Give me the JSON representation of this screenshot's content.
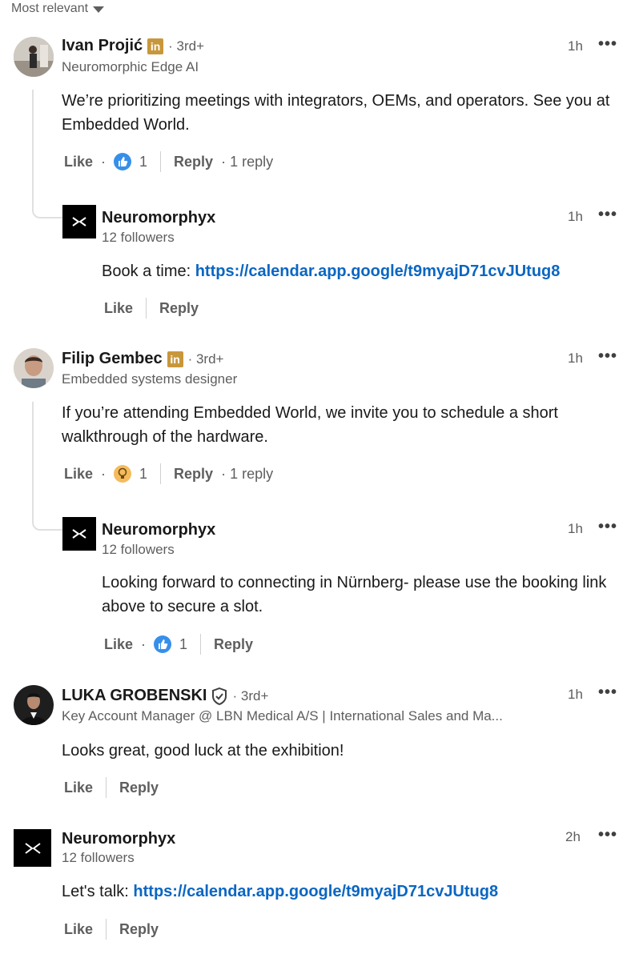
{
  "sort": {
    "label": "Most relevant"
  },
  "actions_common": {
    "like": "Like",
    "reply": "Reply",
    "dot": "·",
    "more": "•••"
  },
  "comments": [
    {
      "name": "Ivan Projić",
      "degree": "· 3rd+",
      "subtitle": "Neuromorphic Edge AI",
      "time": "1h",
      "text": "We’re prioritizing meetings with integrators, OEMs, and operators. See you at Embedded World.",
      "reaction_count": "1",
      "reply_count": "· 1 reply",
      "reply": {
        "name": "Neuromorphyx",
        "subtitle": "12 followers",
        "time": "1h",
        "text_prefix": "Book a time: ",
        "link": "https://calendar.app.google/t9myajD71cvJUtug8"
      }
    },
    {
      "name": "Filip Gembec",
      "degree": "· 3rd+",
      "subtitle": "Embedded systems designer",
      "time": "1h",
      "text": "If you’re attending Embedded World, we invite you to schedule a short walkthrough of the hardware.",
      "reaction_count": "1",
      "reply_count": "· 1 reply",
      "reply": {
        "name": "Neuromorphyx",
        "subtitle": "12 followers",
        "time": "1h",
        "text": "Looking forward to connecting in Nürnberg- please use the booking link above to secure a slot.",
        "reaction_count": "1"
      }
    },
    {
      "name": "LUKA GROBENSKI",
      "degree": "· 3rd+",
      "subtitle": "Key Account Manager @ LBN Medical A/S | International Sales and Ma...",
      "time": "1h",
      "text": "Looks great, good luck at the exhibition!"
    },
    {
      "name": "Neuromorphyx",
      "subtitle": "12 followers",
      "time": "2h",
      "text_prefix": "Let's talk: ",
      "link": "https://calendar.app.google/t9myajD71cvJUtug8"
    }
  ],
  "colors": {
    "link": "#0a66c2",
    "linkedin_badge": "#c8973b",
    "like_reaction": "#378fe9",
    "insight_reaction": "#f5bb5c"
  },
  "icons": [
    "caret-down-icon",
    "linkedin-badge-icon",
    "verified-shield-icon",
    "like-reaction-icon",
    "insightful-reaction-icon",
    "more-icon"
  ]
}
